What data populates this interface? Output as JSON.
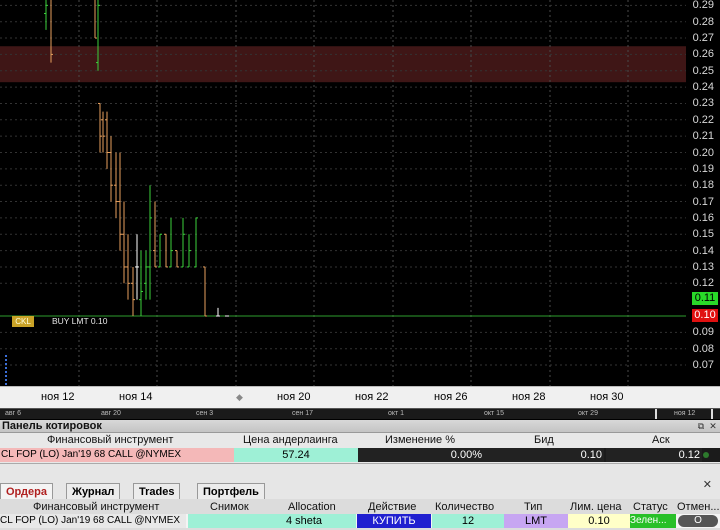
{
  "chart": {
    "order_line": {
      "price": 0.1,
      "tag_label": "CKL",
      "label": "BUY LMT 0.10"
    },
    "highlight_band": {
      "from": 0.243,
      "to": 0.265
    },
    "price_axis": {
      "ticks": [
        "0.29",
        "0.28",
        "0.27",
        "0.26",
        "0.25",
        "0.24",
        "0.23",
        "0.22",
        "0.21",
        "0.20",
        "0.19",
        "0.18",
        "0.17",
        "0.16",
        "0.15",
        "0.14",
        "0.13",
        "0.12",
        "0.09",
        "0.08",
        "0.07"
      ],
      "bid_badge": "0.11",
      "ask_badge": "0.10"
    },
    "date_axis": {
      "labels": [
        "ноя 12",
        "ноя 14",
        "ноя 20",
        "ноя 22",
        "ноя 26",
        "ноя 28",
        "ноя 30"
      ]
    },
    "navigator": {
      "labels": [
        "авг 6",
        "авг 20",
        "сен 3",
        "сен 17",
        "окт 1",
        "окт 15",
        "окт 29",
        "ноя 12"
      ]
    },
    "colors": {
      "up": "#3bd23b",
      "down": "#e8a15e",
      "neutral": "#ffffff",
      "order_line": "#2e9e2e"
    }
  },
  "chart_data": {
    "type": "candlestick",
    "x_label_dates": [
      "ноя 12",
      "ноя 14",
      "ноя 20",
      "ноя 22",
      "ноя 26",
      "ноя 28",
      "ноя 30"
    ],
    "ylim": [
      0.06,
      0.295
    ],
    "bars": [
      {
        "slot": 0,
        "o": 0.285,
        "h": 0.295,
        "l": 0.275,
        "c": 0.29
      },
      {
        "slot": 1,
        "o": 0.295,
        "h": 0.295,
        "l": 0.255,
        "c": 0.26
      },
      {
        "slot": 2,
        "o": 0.295,
        "h": 0.295,
        "l": 0.27,
        "c": 0.27
      },
      {
        "slot": 3,
        "o": 0.255,
        "h": 0.295,
        "l": 0.25,
        "c": 0.29
      },
      {
        "slot": 4,
        "o": 0.23,
        "h": 0.23,
        "l": 0.2,
        "c": 0.21
      },
      {
        "slot": 5,
        "o": 0.22,
        "h": 0.225,
        "l": 0.2,
        "c": 0.21
      },
      {
        "slot": 6,
        "o": 0.22,
        "h": 0.225,
        "l": 0.19,
        "c": 0.2
      },
      {
        "slot": 7,
        "o": 0.2,
        "h": 0.21,
        "l": 0.17,
        "c": 0.18
      },
      {
        "slot": 8,
        "o": 0.18,
        "h": 0.2,
        "l": 0.16,
        "c": 0.17
      },
      {
        "slot": 9,
        "o": 0.17,
        "h": 0.2,
        "l": 0.14,
        "c": 0.15
      },
      {
        "slot": 10,
        "o": 0.15,
        "h": 0.17,
        "l": 0.12,
        "c": 0.13
      },
      {
        "slot": 11,
        "o": 0.13,
        "h": 0.15,
        "l": 0.11,
        "c": 0.12
      },
      {
        "slot": 12,
        "o": 0.12,
        "h": 0.13,
        "l": 0.1,
        "c": 0.11
      },
      {
        "slot": 13,
        "o": 0.13,
        "h": 0.15,
        "l": 0.11,
        "c": 0.13
      },
      {
        "slot": 14,
        "o": 0.11,
        "h": 0.14,
        "l": 0.1,
        "c": 0.115
      },
      {
        "slot": 15,
        "o": 0.12,
        "h": 0.14,
        "l": 0.11,
        "c": 0.13
      },
      {
        "slot": 16,
        "o": 0.13,
        "h": 0.18,
        "l": 0.11,
        "c": 0.16
      },
      {
        "slot": 17,
        "o": 0.14,
        "h": 0.17,
        "l": 0.13,
        "c": 0.13
      },
      {
        "slot": 18,
        "o": 0.13,
        "h": 0.15,
        "l": 0.13,
        "c": 0.15
      },
      {
        "slot": 19,
        "o": 0.15,
        "h": 0.15,
        "l": 0.13,
        "c": 0.13
      },
      {
        "slot": 20,
        "o": 0.13,
        "h": 0.16,
        "l": 0.13,
        "c": 0.14
      },
      {
        "slot": 21,
        "o": 0.14,
        "h": 0.14,
        "l": 0.13,
        "c": 0.13
      },
      {
        "slot": 22,
        "o": 0.13,
        "h": 0.16,
        "l": 0.13,
        "c": 0.15
      },
      {
        "slot": 23,
        "o": 0.13,
        "h": 0.15,
        "l": 0.13,
        "c": 0.14
      },
      {
        "slot": 24,
        "o": 0.13,
        "h": 0.16,
        "l": 0.13,
        "c": 0.16
      },
      {
        "slot": 25,
        "o": 0.13,
        "h": 0.13,
        "l": 0.1,
        "c": 0.1
      },
      {
        "slot": 26,
        "o": 0.1,
        "h": 0.105,
        "l": 0.1,
        "c": 0.1
      },
      {
        "slot": 27,
        "o": 0.1,
        "h": 0.1,
        "l": 0.1,
        "c": 0.1
      }
    ]
  },
  "quote_panel": {
    "title": "Панель котировок",
    "headers": {
      "instrument": "Финансовый инструмент",
      "underlying": "Цена андерлаинга",
      "change": "Изменение %",
      "bid": "Бид",
      "ask": "Аск"
    },
    "row": {
      "instrument": "CL FOP (LO) Jan'19 68 CALL @NYMEX",
      "underlying": "57.24",
      "change": "0.00%",
      "bid": "0.10",
      "ask": "0.12"
    }
  },
  "orders_panel": {
    "tabs": [
      "Ордера",
      "Журнал",
      "Trades",
      "Портфель"
    ],
    "close_glyph": "✕",
    "headers": {
      "instrument": "Финансовый инструмент",
      "snapshot": "Снимок",
      "allocation": "Allocation",
      "action": "Действие",
      "quantity": "Количество",
      "type": "Тип",
      "limit_price": "Лим. цена",
      "status": "Статус",
      "cancel": "Отмен..."
    },
    "row": {
      "instrument": "CL FOP (LO) Jan'19 68 CALL @NYMEX",
      "snapshot": "",
      "allocation": "4 sheta",
      "action": "КУПИТЬ",
      "quantity": "12",
      "type": "LMT",
      "limit_price": "0.10",
      "status": "Зелен...",
      "cancel": "O"
    }
  }
}
